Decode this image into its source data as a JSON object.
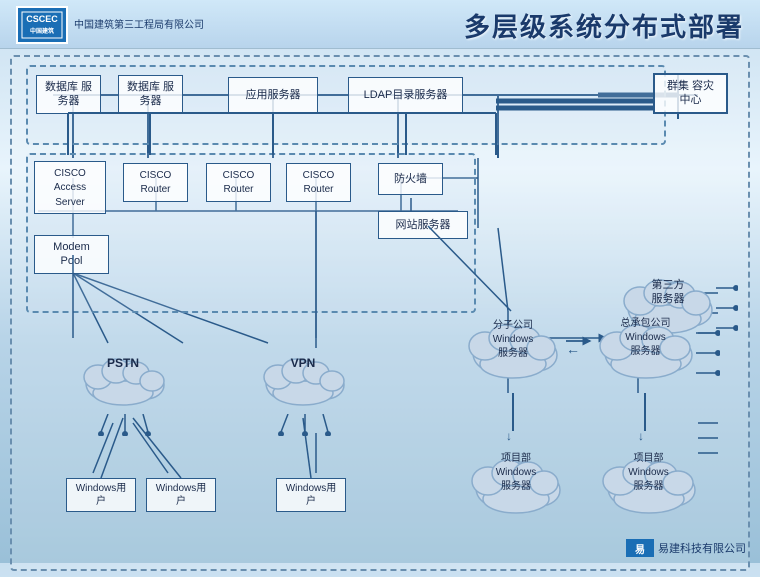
{
  "header": {
    "logo_text": "CSCEC",
    "company_name": "中国建筑第三工程局有限公司",
    "title": "多层级系统分布式部署"
  },
  "nodes": {
    "db_server1": "数据库\n服务器",
    "db_server2": "数据库\n服务器",
    "app_server": "应用服务器",
    "ldap_server": "LDAP目录服务器",
    "cluster": "群集\n容灾中心",
    "cisco_access": "CISCO\nAccess Server",
    "cisco_router1": "CISCO\nRouter",
    "cisco_router2": "CISCO\nRouter",
    "cisco_router3": "CISCO\nRouter",
    "firewall": "防火墙",
    "web_server": "网站服务器",
    "modem_pool": "Modem Pool",
    "pstn": "PSTN",
    "vpn": "VPN",
    "third_party": "第三方\n服务器",
    "branch_windows": "分子公司\nWindows\n服务器",
    "general_windows": "总承包公司\nWindows\n服务器",
    "project_dept1": "项目部\nWindows\n服务器",
    "project_dept2": "项目部\nWindows\n服务器",
    "windows_user1": "Windows用户",
    "windows_user2": "Windows用户",
    "windows_user3": "Windows用户"
  },
  "footer": {
    "brand_icon": "易",
    "brand_name": "易建科技有限公司"
  }
}
